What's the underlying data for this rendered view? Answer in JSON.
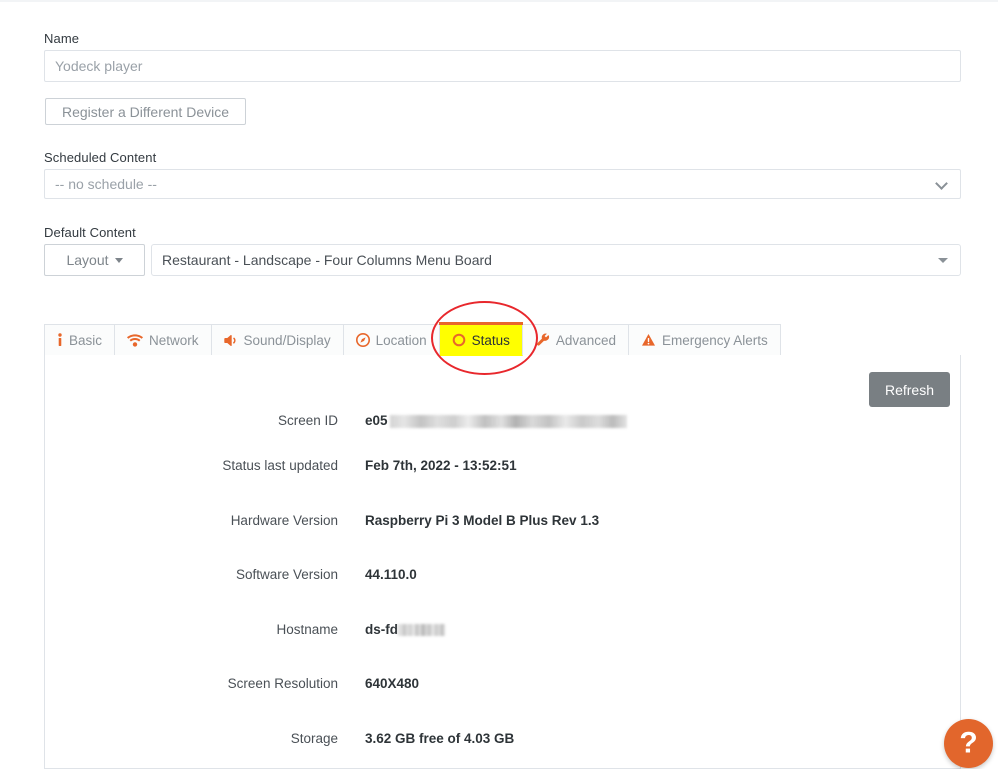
{
  "form": {
    "name_label": "Name",
    "name_placeholder": "Yodeck player",
    "name_value": "",
    "register_button": "Register a Different Device",
    "scheduled_label": "Scheduled Content",
    "scheduled_value": "-- no schedule --",
    "default_label": "Default Content",
    "layout_button": "Layout",
    "default_value": "Restaurant - Landscape - Four Columns Menu Board"
  },
  "tabs": [
    {
      "label": "Basic",
      "icon": "info-icon",
      "active": false
    },
    {
      "label": "Network",
      "icon": "wifi-icon",
      "active": false
    },
    {
      "label": "Sound/Display",
      "icon": "speaker-icon",
      "active": false
    },
    {
      "label": "Location",
      "icon": "compass-icon",
      "active": false
    },
    {
      "label": "Status",
      "icon": "circle-icon",
      "active": true
    },
    {
      "label": "Advanced",
      "icon": "wrench-icon",
      "active": false
    },
    {
      "label": "Emergency Alerts",
      "icon": "warning-icon",
      "active": false
    }
  ],
  "panel": {
    "refresh_label": "Refresh",
    "rows": [
      {
        "label": "Screen ID",
        "value": "e05",
        "redacted": "wide"
      },
      {
        "label": "Status last updated",
        "value": "Feb 7th, 2022 - 13:52:51",
        "redacted": ""
      },
      {
        "label": "Hardware Version",
        "value": "Raspberry Pi 3 Model B Plus Rev 1.3",
        "redacted": ""
      },
      {
        "label": "Software Version",
        "value": "44.110.0",
        "redacted": ""
      },
      {
        "label": "Hostname",
        "value": "ds-fd",
        "redacted": "small"
      },
      {
        "label": "Screen Resolution",
        "value": "640X480",
        "redacted": ""
      },
      {
        "label": "Storage",
        "value": "3.62 GB free of 4.03 GB",
        "redacted": ""
      }
    ]
  },
  "help": {
    "glyph": "?"
  },
  "colors": {
    "accent": "#e8672b",
    "highlight": "#ffff00",
    "annotation": "#e8272c",
    "refresh_bg": "#797f83",
    "help_bg": "#e2662c"
  }
}
